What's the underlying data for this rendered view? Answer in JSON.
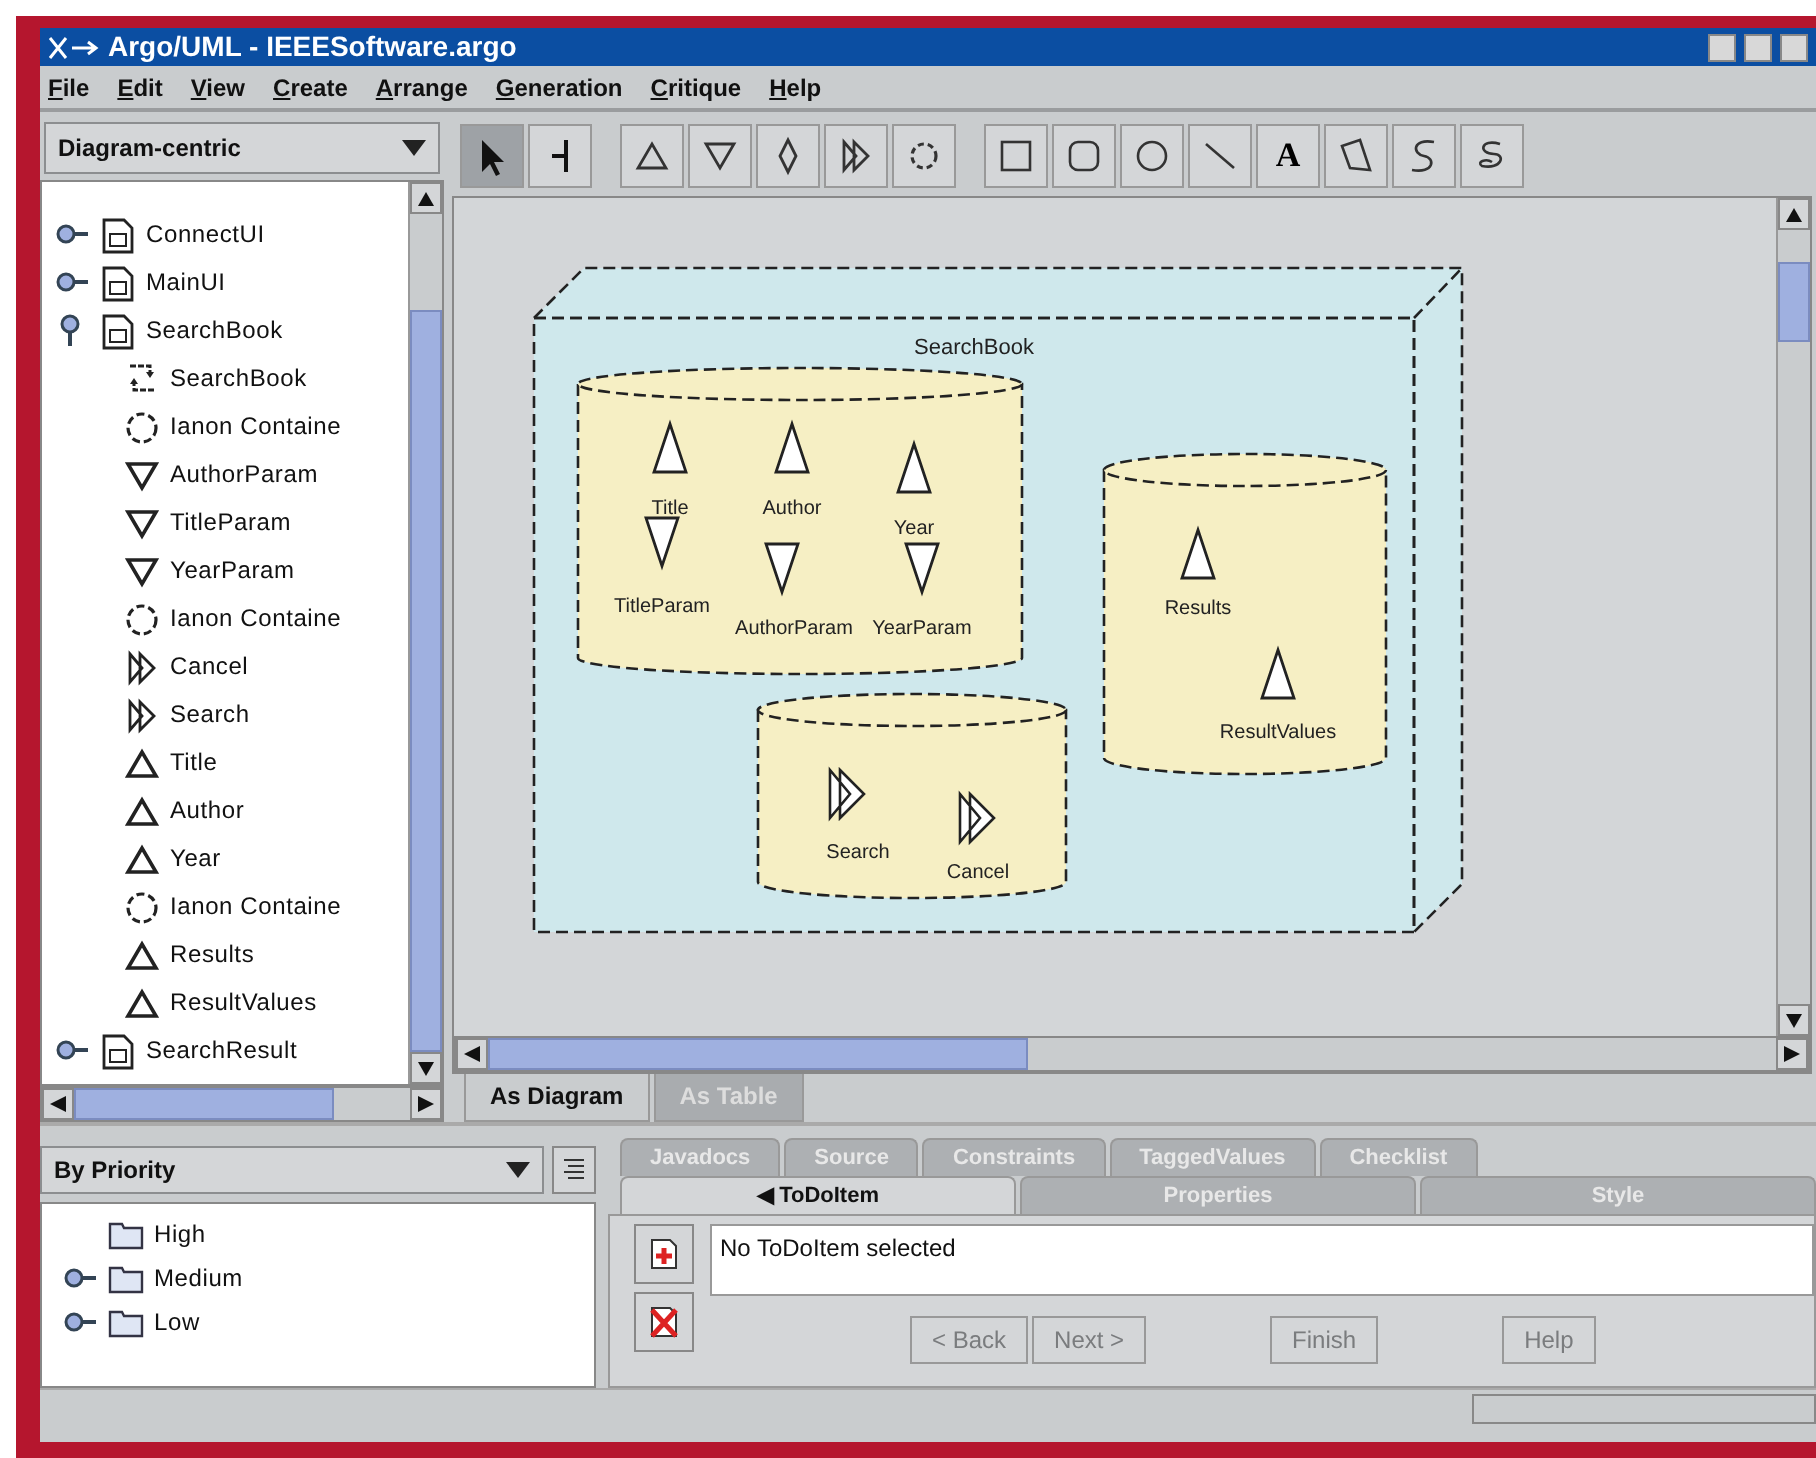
{
  "window": {
    "title": "Argo/UML - IEEESoftware.argo"
  },
  "menu": [
    "File",
    "Edit",
    "View",
    "Create",
    "Arrange",
    "Generation",
    "Critique",
    "Help"
  ],
  "perspective": {
    "value": "Diagram-centric"
  },
  "navigator": [
    {
      "label": "ConnectUI",
      "kind": "diagram",
      "expanded": false
    },
    {
      "label": "MainUI",
      "kind": "diagram",
      "expanded": false
    },
    {
      "label": "SearchBook",
      "kind": "diagram",
      "expanded": true,
      "children": [
        {
          "label": "SearchBook",
          "kind": "state"
        },
        {
          "label": "Ianon Containe",
          "kind": "container"
        },
        {
          "label": "AuthorParam",
          "kind": "out"
        },
        {
          "label": "TitleParam",
          "kind": "out"
        },
        {
          "label": "YearParam",
          "kind": "out"
        },
        {
          "label": "Ianon Containe",
          "kind": "container"
        },
        {
          "label": "Cancel",
          "kind": "action"
        },
        {
          "label": "Search",
          "kind": "action"
        },
        {
          "label": "Title",
          "kind": "in"
        },
        {
          "label": "Author",
          "kind": "in"
        },
        {
          "label": "Year",
          "kind": "in"
        },
        {
          "label": "Ianon Containe",
          "kind": "container"
        },
        {
          "label": "Results",
          "kind": "in"
        },
        {
          "label": "ResultValues",
          "kind": "in"
        }
      ]
    },
    {
      "label": "SearchResult",
      "kind": "diagram",
      "expanded": false
    }
  ],
  "toolbar": {
    "groups": [
      {
        "tools": [
          {
            "kind": "select",
            "selected": true
          },
          {
            "kind": "edge",
            "selected": false
          }
        ]
      },
      {
        "tools": [
          {
            "kind": "in",
            "selected": false
          },
          {
            "kind": "out",
            "selected": false
          },
          {
            "kind": "diamond",
            "selected": false
          },
          {
            "kind": "action",
            "selected": false
          },
          {
            "kind": "container",
            "selected": false
          }
        ]
      },
      {
        "tools": [
          {
            "kind": "rect",
            "selected": false
          },
          {
            "kind": "rrect",
            "selected": false
          },
          {
            "kind": "circle",
            "selected": false
          },
          {
            "kind": "line",
            "selected": false
          },
          {
            "kind": "text",
            "label": "A",
            "selected": false
          },
          {
            "kind": "polygon",
            "selected": false
          },
          {
            "kind": "spline",
            "selected": false
          },
          {
            "kind": "ink",
            "selected": false
          }
        ]
      }
    ]
  },
  "diagram": {
    "title": "SearchBook",
    "containers": [
      {
        "items": [
          {
            "kind": "in",
            "label": "Title"
          },
          {
            "kind": "in",
            "label": "Author"
          },
          {
            "kind": "in",
            "label": "Year"
          },
          {
            "kind": "out",
            "label": "TitleParam"
          },
          {
            "kind": "out",
            "label": "AuthorParam"
          },
          {
            "kind": "out",
            "label": "YearParam"
          }
        ]
      },
      {
        "items": [
          {
            "kind": "in",
            "label": "Results"
          },
          {
            "kind": "in",
            "label": "ResultValues"
          }
        ]
      },
      {
        "items": [
          {
            "kind": "action",
            "label": "Search"
          },
          {
            "kind": "action",
            "label": "Cancel"
          }
        ]
      }
    ]
  },
  "view_tabs": [
    {
      "label": "As Diagram",
      "selected": true
    },
    {
      "label": "As Table",
      "selected": false
    }
  ],
  "todo_pane": {
    "ordering": "By Priority",
    "items": [
      {
        "label": "High",
        "kind": "folder"
      },
      {
        "label": "Medium",
        "kind": "folder",
        "expanded": false
      },
      {
        "label": "Low",
        "kind": "folder",
        "expanded": false
      }
    ]
  },
  "detail_tabs": [
    [
      {
        "label": "Javadocs",
        "selected": false,
        "disabled": true
      },
      {
        "label": "Source",
        "selected": false,
        "disabled": true
      },
      {
        "label": "Constraints",
        "selected": false,
        "disabled": true
      },
      {
        "label": "TaggedValues",
        "selected": false,
        "disabled": true
      },
      {
        "label": "Checklist",
        "selected": false,
        "disabled": true
      }
    ],
    [
      {
        "label": "◀ ToDoItem",
        "selected": true,
        "disabled": false
      },
      {
        "label": "Properties",
        "selected": false,
        "disabled": true
      },
      {
        "label": "Style",
        "selected": false,
        "disabled": true
      }
    ]
  ],
  "todo_text": "No ToDoItem selected",
  "wizard_buttons": [
    {
      "label": "< Back",
      "disabled": true
    },
    {
      "label": "Next >",
      "disabled": true
    },
    {
      "label": "Finish",
      "disabled": true
    },
    {
      "label": "Help",
      "disabled": true
    }
  ]
}
